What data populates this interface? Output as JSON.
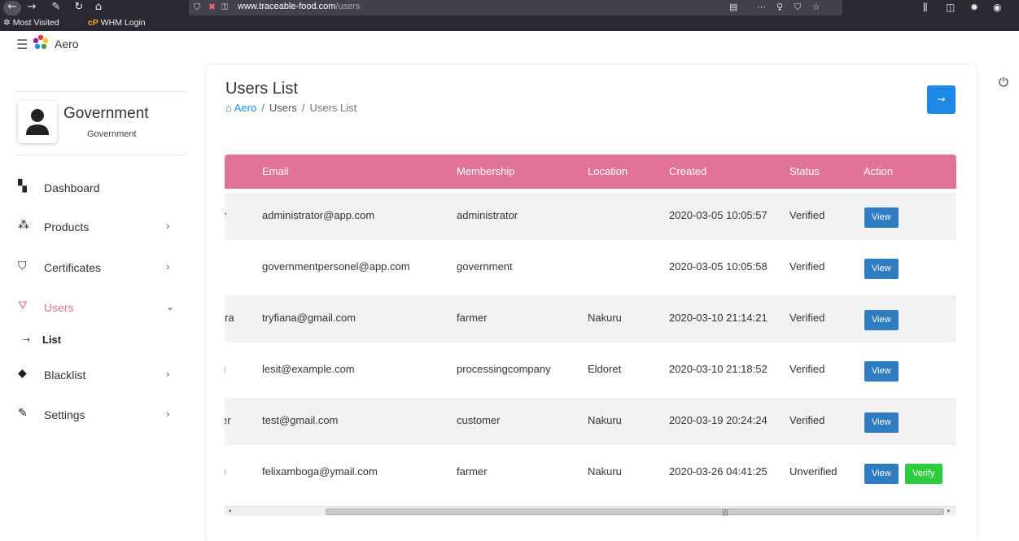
{
  "browser": {
    "url_host": "www.traceable-food.com",
    "url_path": "/users",
    "bookmarks": [
      "Most Visited",
      "WHM Login"
    ]
  },
  "sidebar": {
    "brand": "Aero",
    "profile_name": "Government",
    "profile_role": "Government",
    "items": [
      {
        "label": "Dashboard",
        "icon": "dashboard-icon",
        "chevron": ""
      },
      {
        "label": "Products",
        "icon": "products-icon",
        "chevron": "›"
      },
      {
        "label": "Certificates",
        "icon": "certificates-icon",
        "chevron": "›"
      },
      {
        "label": "Users",
        "icon": "users-icon",
        "chevron": "⌄"
      },
      {
        "label": "Blacklist",
        "icon": "blacklist-icon",
        "chevron": "›"
      },
      {
        "label": "Settings",
        "icon": "settings-icon",
        "chevron": "›"
      }
    ],
    "sub_item": "List"
  },
  "header": {
    "title": "Users List",
    "breadcrumb": [
      "Aero",
      "Users",
      "Users List"
    ]
  },
  "table": {
    "columns": [
      "Email",
      "Membership",
      "Location",
      "Created",
      "Status",
      "Action"
    ],
    "rows": [
      {
        "name_fragment": "r",
        "email": "administrator@app.com",
        "membership": "administrator",
        "location": "",
        "created": "2020-03-05 10:05:57",
        "status": "Verified",
        "actions": [
          "View"
        ]
      },
      {
        "name_fragment": "",
        "email": "governmentpersonel@app.com",
        "membership": "government",
        "location": "",
        "created": "2020-03-05 10:05:58",
        "status": "Verified",
        "actions": [
          "View"
        ]
      },
      {
        "name_fragment": "nira",
        "email": "tryfiana@gmail.com",
        "membership": "farmer",
        "location": "Nakuru",
        "created": "2020-03-10 21:14:21",
        "status": "Verified",
        "actions": [
          "View"
        ]
      },
      {
        "name_fragment": "ı",
        "email": "lesit@example.com",
        "membership": "processingcompany",
        "location": "Eldoret",
        "created": "2020-03-10 21:18:52",
        "status": "Verified",
        "actions": [
          "View"
        ]
      },
      {
        "name_fragment": "er",
        "email": "test@gmail.com",
        "membership": "customer",
        "location": "Nakuru",
        "created": "2020-03-19 20:24:24",
        "status": "Verified",
        "actions": [
          "View"
        ]
      },
      {
        "name_fragment": "ı",
        "email": "felixamboga@ymail.com",
        "membership": "farmer",
        "location": "Nakuru",
        "created": "2020-03-26 04:41:25",
        "status": "Unverified",
        "actions": [
          "View",
          "Verify"
        ]
      }
    ]
  },
  "colors": {
    "table_header": "#e17397",
    "view_button": "#2f7cc0",
    "verify_button": "#2ecc40",
    "primary_button": "#1e88e5",
    "active_menu": "#e17397"
  }
}
